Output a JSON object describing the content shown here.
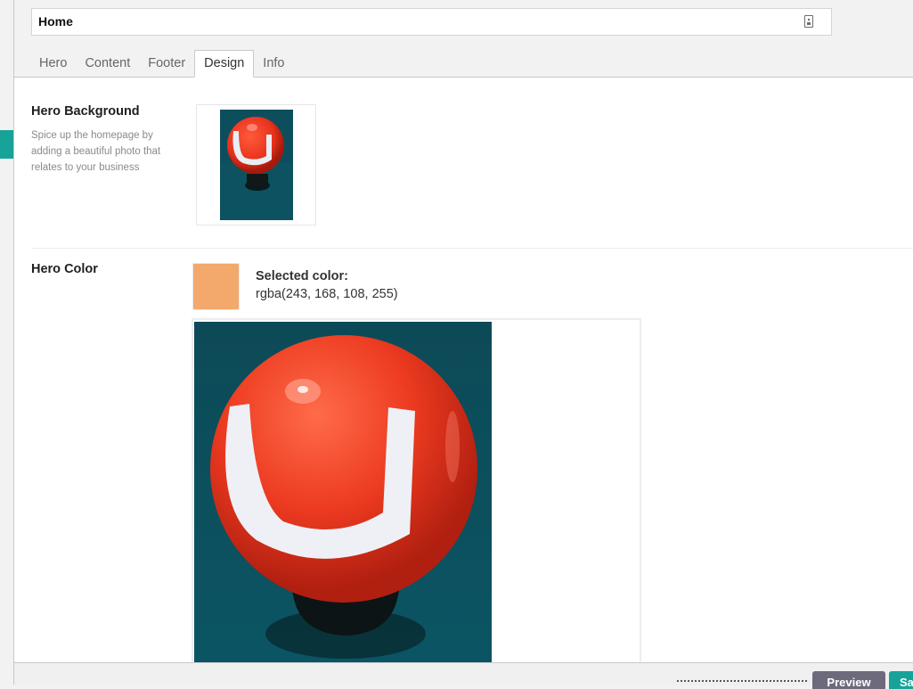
{
  "page": {
    "title_value": "Home",
    "title_icon": "document-icon"
  },
  "tabs": [
    {
      "label": "Hero"
    },
    {
      "label": "Content"
    },
    {
      "label": "Footer"
    },
    {
      "label": "Design",
      "active": true
    },
    {
      "label": "Info"
    }
  ],
  "hero_background": {
    "title": "Hero Background",
    "description": "Spice up the homepage by adding a beautiful photo that relates to your business"
  },
  "hero_color": {
    "title": "Hero Color",
    "selected_label": "Selected color:",
    "selected_value": "rgba(243, 168, 108, 255)",
    "swatch_color": "#f3a86c"
  },
  "footer": {
    "preview_label": "Preview",
    "save_label": "Save"
  },
  "colors": {
    "accent": "#17a398",
    "preview_button": "#6d6a7c"
  }
}
